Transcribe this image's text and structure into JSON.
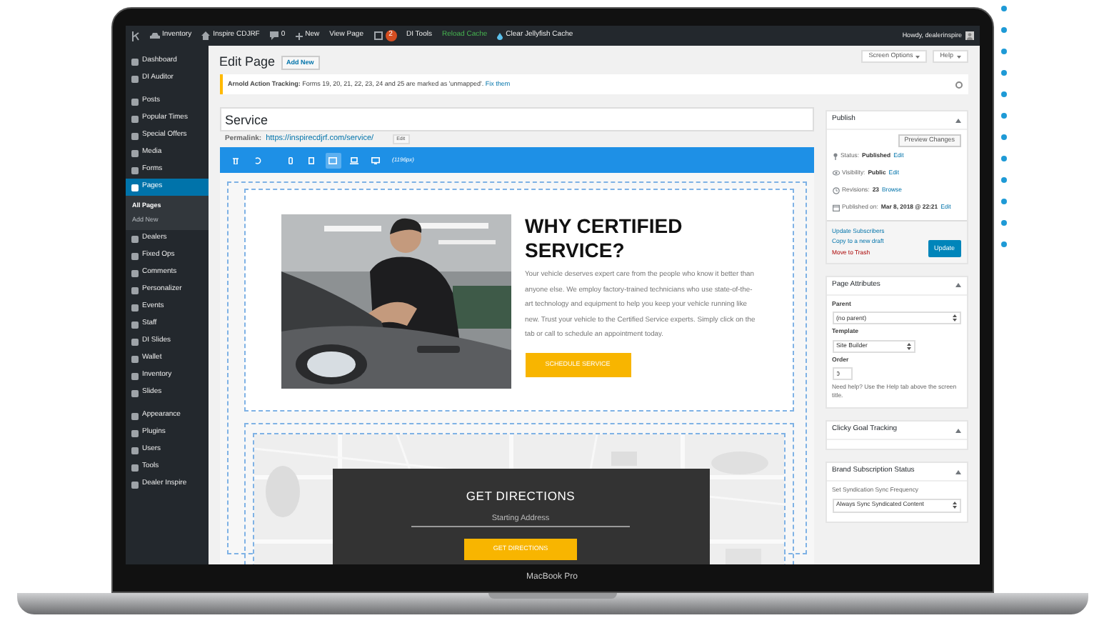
{
  "admin_bar": {
    "items": [
      {
        "kind": "logo"
      },
      {
        "kind": "car",
        "label": "Inventory"
      },
      {
        "kind": "home",
        "label": "Inspire CDJRF"
      },
      {
        "kind": "comment",
        "label": "0"
      },
      {
        "kind": "plus",
        "label": "New"
      },
      {
        "kind": "text",
        "label": "View Page"
      },
      {
        "kind": "badge",
        "label": "2"
      },
      {
        "kind": "text",
        "label": "DI Tools"
      },
      {
        "kind": "text",
        "label": "Reload Cache",
        "color": "#46b450"
      },
      {
        "kind": "drop",
        "label": "Clear Jellyfish Cache"
      }
    ],
    "greeting": "Howdy, dealerinspire"
  },
  "sidebar": {
    "sections": [
      [
        {
          "label": "Dashboard",
          "selected": false
        },
        {
          "label": "DI Auditor",
          "selected": false
        }
      ],
      [
        {
          "label": "Posts",
          "selected": false
        },
        {
          "label": "Popular Times",
          "selected": false
        },
        {
          "label": "Special Offers",
          "selected": false
        },
        {
          "label": "Media",
          "selected": false
        },
        {
          "label": "Forms",
          "selected": false
        },
        {
          "label": "Pages",
          "selected": true,
          "children": [
            {
              "label": "All Pages",
              "selected": true
            },
            {
              "label": "Add New",
              "selected": false
            }
          ]
        },
        {
          "label": "Dealers",
          "selected": false
        },
        {
          "label": "Fixed Ops",
          "selected": false
        },
        {
          "label": "Comments",
          "selected": false
        },
        {
          "label": "Personalizer",
          "selected": false
        },
        {
          "label": "Events",
          "selected": false
        },
        {
          "label": "Staff",
          "selected": false
        },
        {
          "label": "DI Slides",
          "selected": false
        },
        {
          "label": "Wallet",
          "selected": false
        },
        {
          "label": "Inventory",
          "selected": false
        },
        {
          "label": "Slides",
          "selected": false
        }
      ],
      [
        {
          "label": "Appearance",
          "selected": false
        },
        {
          "label": "Plugins",
          "selected": false
        },
        {
          "label": "Users",
          "selected": false
        },
        {
          "label": "Tools",
          "selected": false
        },
        {
          "label": "Dealer Inspire",
          "selected": false
        }
      ]
    ]
  },
  "header": {
    "title": "Edit Page",
    "add_new": "Add New",
    "screen_options": "Screen Options",
    "help": "Help"
  },
  "notice": {
    "text": "**Arnold Action Tracking:** Forms 19, 20, 21, 22, 23, 24 and 25 are marked as 'unmapped'.",
    "link": "Fix them"
  },
  "title_field": {
    "value": "Service"
  },
  "permalink": {
    "label": "Permalink:",
    "url": "https://inspirecdjrf.com/service/",
    "button": "Edit"
  },
  "builder_toolbar": {
    "tools": [
      {
        "kind": "trash",
        "selected": false
      },
      {
        "kind": "undo",
        "selected": false
      },
      {
        "kind": "phone",
        "selected": false
      },
      {
        "kind": "tablet",
        "selected": false
      },
      {
        "kind": "tablet-landscape",
        "selected": true
      },
      {
        "kind": "laptop",
        "selected": false
      },
      {
        "kind": "desktop",
        "selected": false
      }
    ],
    "width_label": "(1196px)"
  },
  "hero": {
    "heading": "WHY CERTIFIED SERVICE?",
    "body": "Your vehicle deserves expert care from the people who know it better than anyone else. We employ factory-trained technicians who use state-of-the-art technology and equipment to help you keep your vehicle running like new. Trust your vehicle to the Certified Service experts. Simply click on the tab or call to schedule an appointment today.",
    "button": "SCHEDULE SERVICE"
  },
  "directions": {
    "heading": "GET DIRECTIONS",
    "placeholder": "Starting Address",
    "button": "GET DIRECTIONS"
  },
  "publish": {
    "title": "Publish",
    "preview": "Preview Changes",
    "meta": [
      {
        "kind": "pin",
        "label": "Status:",
        "value": "Published",
        "link": "Edit"
      },
      {
        "kind": "eye",
        "label": "Visibility:",
        "value": "Public",
        "link": "Edit"
      },
      {
        "kind": "clock",
        "label": "Revisions:",
        "value": "23",
        "link": "Browse"
      },
      {
        "kind": "calendar",
        "label": "Published on:",
        "value": "Mar 8, 2018 @ 22:21",
        "link": "Edit"
      }
    ],
    "links": [
      {
        "label": "Update Subscribers",
        "kind": "link"
      },
      {
        "label": "Copy to a new draft",
        "kind": "link"
      },
      {
        "label": "Move to Trash",
        "kind": "danger"
      }
    ],
    "button": "Update"
  },
  "page_attributes": {
    "title": "Page Attributes",
    "parent_label": "Parent",
    "parent": "(no parent)",
    "template_label": "Template",
    "template": "Site Builder",
    "order_label": "Order",
    "order": "0",
    "help": "Need help? Use the Help tab above the screen title."
  },
  "clicky": {
    "title": "Clicky Goal Tracking"
  },
  "brand_subscription": {
    "title": "Brand Subscription Status",
    "label": "Set Syndication Sync Frequency",
    "value": "Always Sync Syndicated Content"
  },
  "laptop_label": "MacBook Pro"
}
